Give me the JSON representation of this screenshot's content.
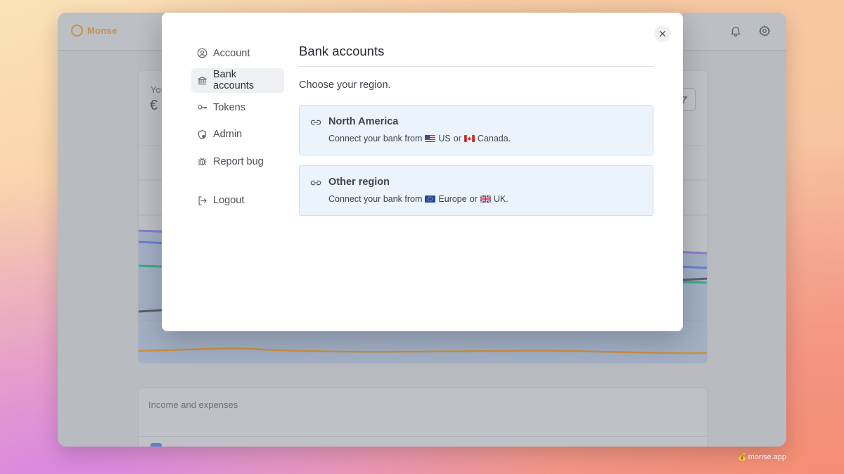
{
  "app": {
    "brand_name": "Monse",
    "accent_color": "#c9913e",
    "icons": [
      "bell-icon",
      "gear-icon"
    ]
  },
  "background": {
    "balance_label_partial": "You",
    "currency_partial": "€",
    "income_card_title": "Income and expenses"
  },
  "modal": {
    "nav": [
      {
        "label": "Account",
        "icon": "user-circle-icon",
        "active": false
      },
      {
        "label": "Bank accounts",
        "icon": "bank-icon",
        "active": true
      },
      {
        "label": "Tokens",
        "icon": "key-icon",
        "active": false
      },
      {
        "label": "Admin",
        "icon": "shield-icon",
        "active": false
      },
      {
        "label": "Report bug",
        "icon": "bug-icon",
        "active": false
      }
    ],
    "logout": {
      "label": "Logout",
      "icon": "logout-icon"
    },
    "title": "Bank accounts",
    "subtitle": "Choose your region.",
    "regions": [
      {
        "title": "North America",
        "desc_prefix": "Connect your bank from",
        "first": "US",
        "joiner": "or",
        "second": "Canada.",
        "icon": "link-icon"
      },
      {
        "title": "Other region",
        "desc_prefix": "Connect your bank from",
        "first": "Europe",
        "joiner": "or",
        "second": "UK.",
        "icon": "link-icon"
      }
    ]
  },
  "watermark": "monse.app"
}
